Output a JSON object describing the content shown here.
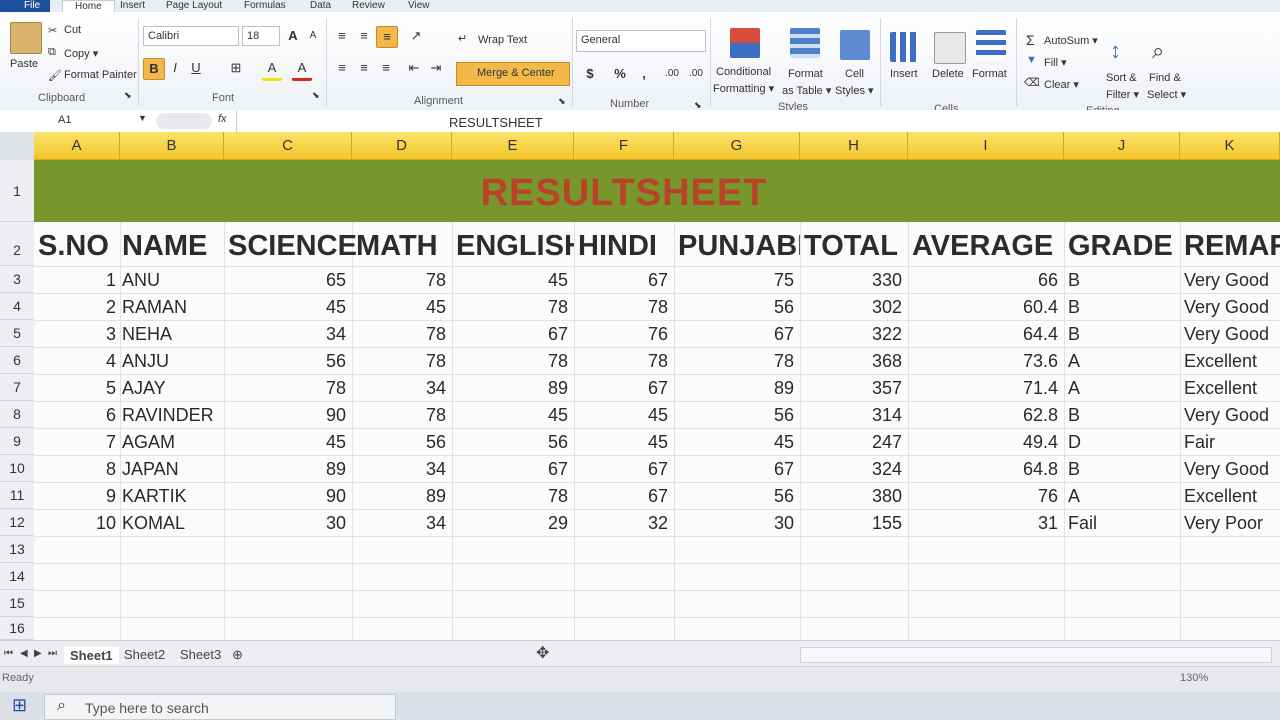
{
  "menu": {
    "tabs": [
      "File",
      "Home",
      "Insert",
      "Page Layout",
      "Formulas",
      "Data",
      "Review",
      "View"
    ]
  },
  "ribbon": {
    "clipboard": {
      "paste": "Paste",
      "cut": "Cut",
      "copy": "Copy ▾",
      "format_painter": "Format Painter",
      "label": "Clipboard"
    },
    "font": {
      "name": "Calibri",
      "size": "18",
      "bold": "B",
      "italic": "I",
      "underline": "U",
      "grow": "A",
      "shrink": "A",
      "fill": "A",
      "color": "A",
      "label": "Font"
    },
    "alignment": {
      "wrap": "Wrap Text",
      "merge": "Merge & Center",
      "label": "Alignment"
    },
    "number": {
      "format": "General",
      "currency": "$",
      "percent": "%",
      "comma": ",",
      "inc_dec": ".00",
      "dec_dec": ".00",
      "label": "Number"
    },
    "styles": {
      "conditional_1": "Conditional",
      "conditional_2": "Formatting ▾",
      "table_1": "Format",
      "table_2": "as Table ▾",
      "cell_1": "Cell",
      "cell_2": "Styles ▾",
      "label": "Styles"
    },
    "cells": {
      "insert": "Insert",
      "delete": "Delete",
      "format": "Format",
      "label": "Cells"
    },
    "editing": {
      "autosum": "AutoSum ▾",
      "fill": "Fill ▾",
      "clear": "Clear ▾",
      "sort_1": "Sort &",
      "sort_2": "Filter ▾",
      "find_1": "Find &",
      "find_2": "Select ▾",
      "label": "Editing"
    }
  },
  "formula_bar": {
    "name_box": "A1",
    "fx": "fx",
    "value": "RESULTSHEET"
  },
  "columns": [
    "A",
    "B",
    "C",
    "D",
    "E",
    "F",
    "G",
    "H",
    "I",
    "J",
    "K"
  ],
  "rows": [
    "1",
    "2",
    "3",
    "4",
    "5",
    "6",
    "7",
    "8",
    "9",
    "10",
    "11",
    "12",
    "13",
    "14",
    "15",
    "16"
  ],
  "sheet": {
    "title": "RESULTSHEET",
    "headers": [
      "S.NO",
      "NAME",
      "SCIENCE",
      "MATH",
      "ENGLISH",
      "HINDI",
      "PUNJABI",
      "TOTAL",
      "AVERAGE",
      "GRADE",
      "REMAR"
    ],
    "data": [
      [
        "1",
        "ANU",
        "65",
        "78",
        "45",
        "67",
        "75",
        "330",
        "66",
        "B",
        "Very Good"
      ],
      [
        "2",
        "RAMAN",
        "45",
        "45",
        "78",
        "78",
        "56",
        "302",
        "60.4",
        "B",
        "Very Good"
      ],
      [
        "3",
        "NEHA",
        "34",
        "78",
        "67",
        "76",
        "67",
        "322",
        "64.4",
        "B",
        "Very Good"
      ],
      [
        "4",
        "ANJU",
        "56",
        "78",
        "78",
        "78",
        "78",
        "368",
        "73.6",
        "A",
        "Excellent"
      ],
      [
        "5",
        "AJAY",
        "78",
        "34",
        "89",
        "67",
        "89",
        "357",
        "71.4",
        "A",
        "Excellent"
      ],
      [
        "6",
        "RAVINDER",
        "90",
        "78",
        "45",
        "45",
        "56",
        "314",
        "62.8",
        "B",
        "Very Good"
      ],
      [
        "7",
        "AGAM",
        "45",
        "56",
        "56",
        "45",
        "45",
        "247",
        "49.4",
        "D",
        "Fair"
      ],
      [
        "8",
        "JAPAN",
        "89",
        "34",
        "67",
        "67",
        "67",
        "324",
        "64.8",
        "B",
        "Very Good"
      ],
      [
        "9",
        "KARTIK",
        "90",
        "89",
        "78",
        "67",
        "56",
        "380",
        "76",
        "A",
        "Excellent"
      ],
      [
        "10",
        "KOMAL",
        "30",
        "34",
        "29",
        "32",
        "30",
        "155",
        "31",
        "Fail",
        "Very Poor"
      ]
    ]
  },
  "sheet_tabs": [
    "Sheet1",
    "Sheet2",
    "Sheet3"
  ],
  "status": {
    "ready": "Ready",
    "zoom": "130%"
  },
  "taskbar": {
    "search_placeholder": "Type here to search"
  },
  "colors": {
    "banner": "#77962c",
    "title": "#b84328",
    "col_header": "#f3c62c"
  }
}
